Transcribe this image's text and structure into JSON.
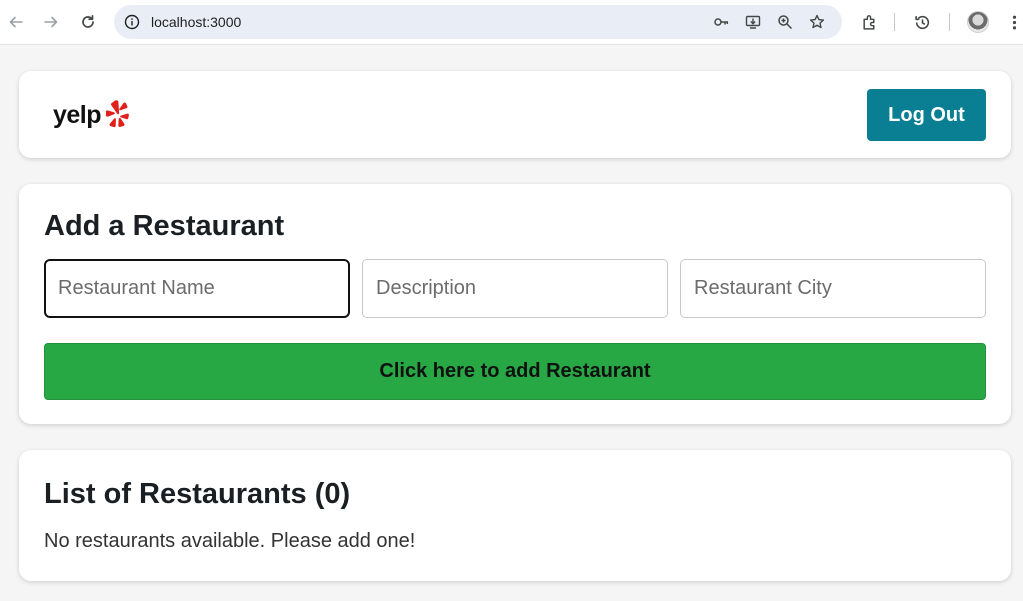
{
  "browser": {
    "url": "localhost:3000"
  },
  "header": {
    "logo_text": "yelp",
    "logout_label": "Log Out"
  },
  "add_form": {
    "title": "Add a Restaurant",
    "name_placeholder": "Restaurant Name",
    "description_placeholder": "Description",
    "city_placeholder": "Restaurant City",
    "submit_label": "Click here to add Restaurant"
  },
  "restaurant_list": {
    "title": "List of Restaurants (0)",
    "empty_message": "No restaurants available. Please add one!"
  },
  "colors": {
    "logout_button": "#0a7e92",
    "add_button": "#28a745",
    "logo_burst": "#e0201b"
  }
}
